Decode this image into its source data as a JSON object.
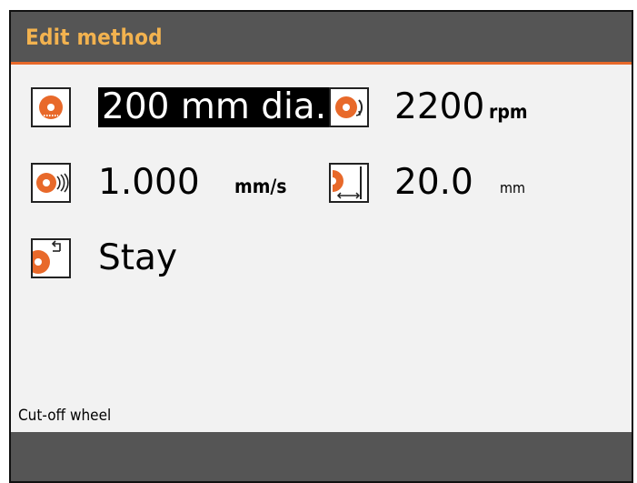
{
  "header": {
    "title": "Edit method"
  },
  "params": {
    "wheel_diameter": {
      "value": "200 mm dia.",
      "icon": "wheel-diameter-icon"
    },
    "speed": {
      "value": "2200",
      "unit": "rpm",
      "icon": "wheel-rotation-icon"
    },
    "feed": {
      "value": "1.000",
      "unit": "mm/s",
      "icon": "feed-speed-icon"
    },
    "cut_length": {
      "value": "20.0",
      "unit": "mm",
      "icon": "cut-length-icon"
    },
    "end_position": {
      "value": "Stay",
      "icon": "return-position-icon"
    }
  },
  "status": {
    "text": "Cut-off wheel"
  },
  "colors": {
    "accent": "#e8692a",
    "title": "#f2b24f",
    "header_bg": "#555555",
    "panel_bg": "#f2f2f2"
  }
}
